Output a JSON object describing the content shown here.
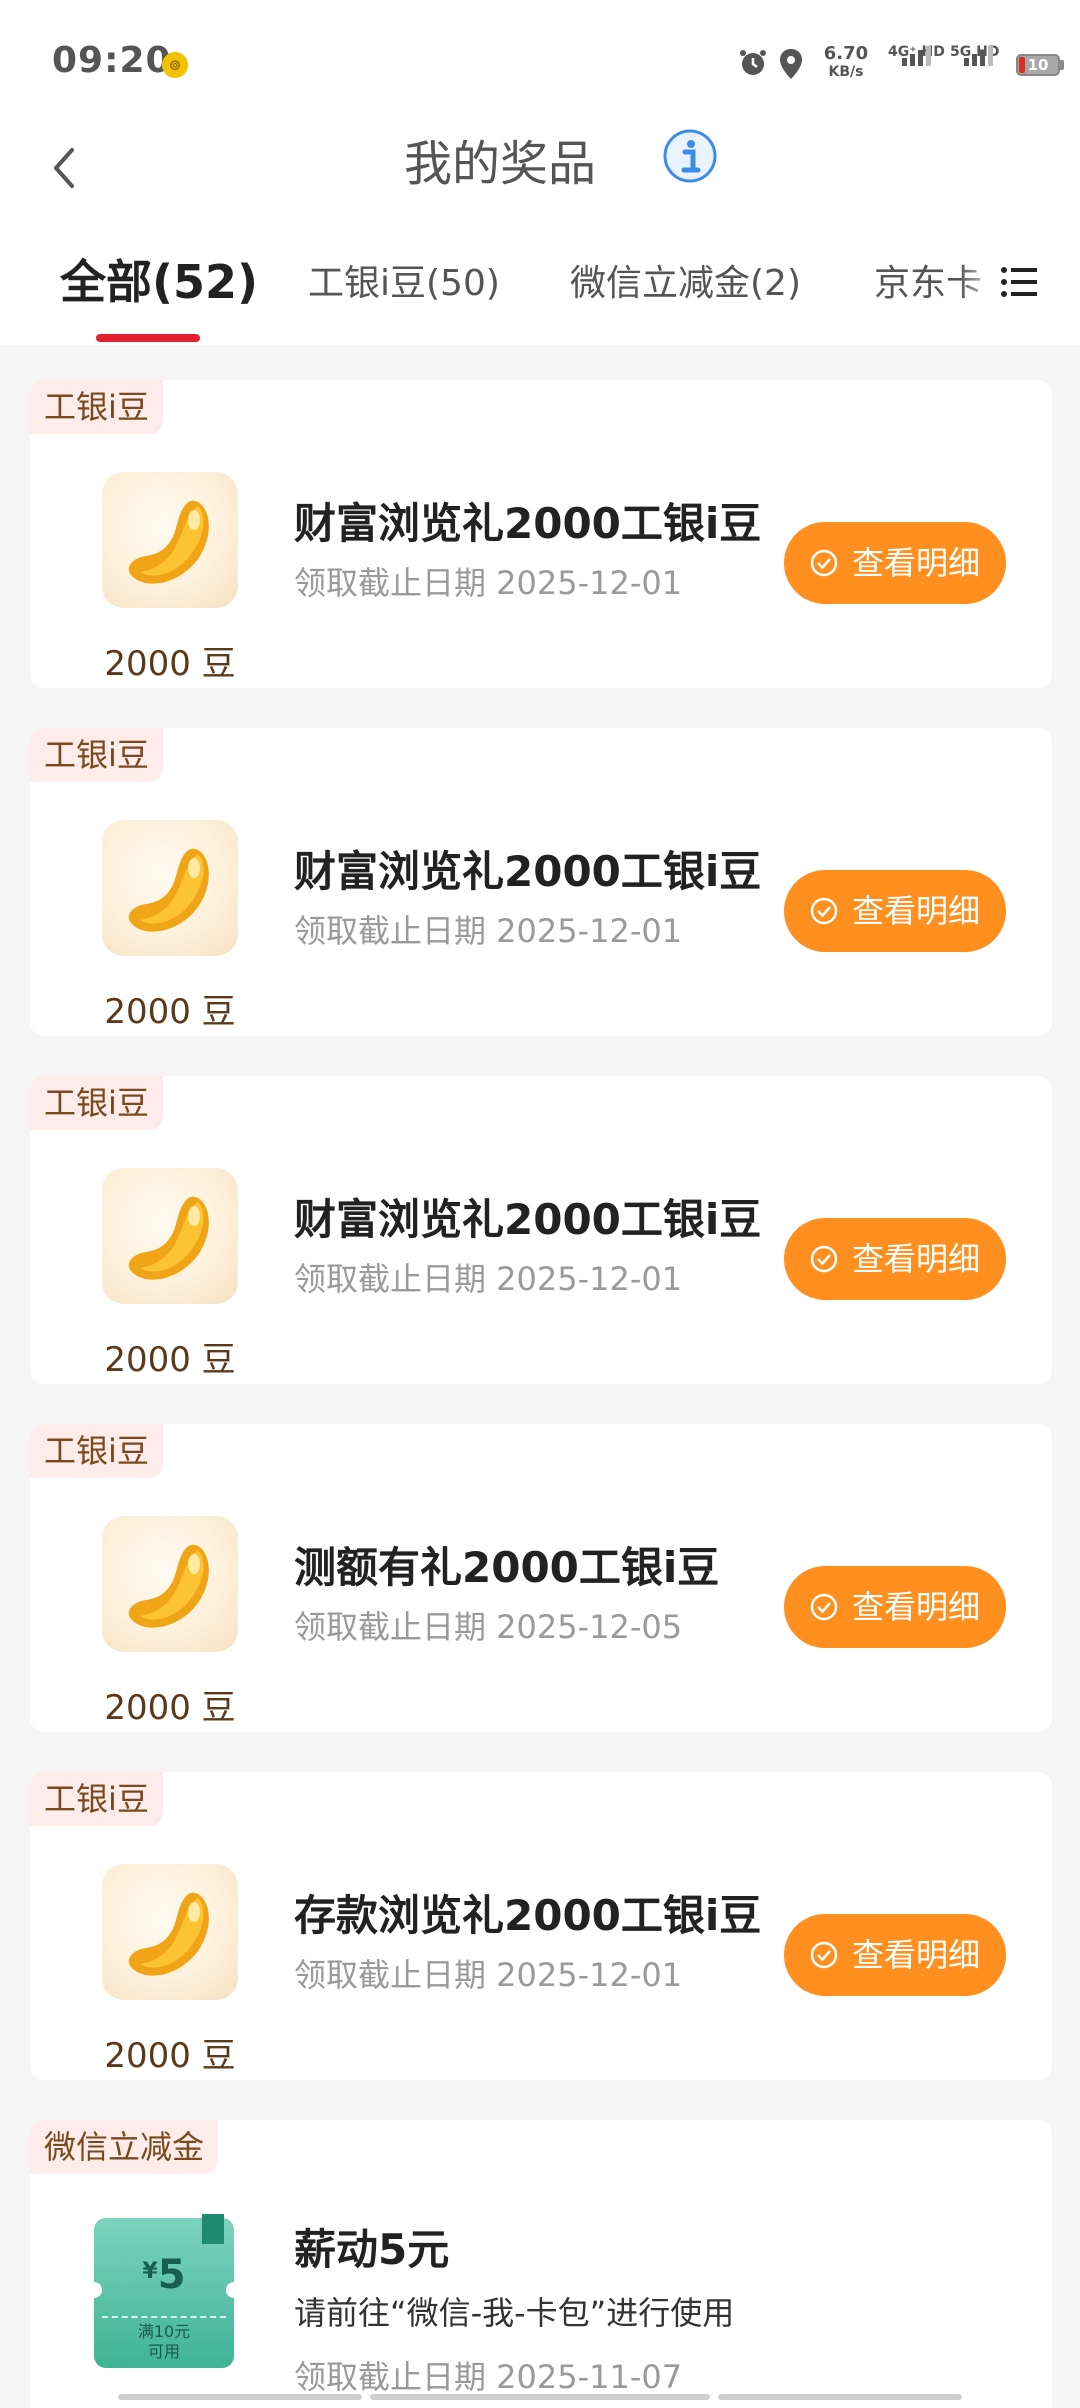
{
  "status_bar": {
    "time": "09:20",
    "speed_value": "6.70",
    "speed_unit": "KB/s",
    "net1": "4G⁺ HD",
    "net2": "5G HD",
    "battery": "10"
  },
  "header": {
    "title": "我的奖品"
  },
  "tabs": [
    {
      "label": "全部(52)"
    },
    {
      "label": "工银i豆(50)"
    },
    {
      "label": "微信立减金(2)"
    },
    {
      "label": "京东卡"
    }
  ],
  "cards": [
    {
      "tag": "工银i豆",
      "title": "财富浏览礼2000工银i豆",
      "date": "领取截止日期 2025-12-01",
      "amount": "2000 豆",
      "button": "查看明细"
    },
    {
      "tag": "工银i豆",
      "title": "财富浏览礼2000工银i豆",
      "date": "领取截止日期 2025-12-01",
      "amount": "2000 豆",
      "button": "查看明细"
    },
    {
      "tag": "工银i豆",
      "title": "财富浏览礼2000工银i豆",
      "date": "领取截止日期 2025-12-01",
      "amount": "2000 豆",
      "button": "查看明细"
    },
    {
      "tag": "工银i豆",
      "title": "测额有礼2000工银i豆",
      "date": "领取截止日期 2025-12-05",
      "amount": "2000 豆",
      "button": "查看明细"
    },
    {
      "tag": "工银i豆",
      "title": "存款浏览礼2000工银i豆",
      "date": "领取截止日期 2025-12-01",
      "amount": "2000 豆",
      "button": "查看明细"
    }
  ],
  "wechat_card": {
    "tag": "微信立减金",
    "title": "薪动5元",
    "instruction": "请前往“微信-我-卡包”进行使用",
    "date": "领取截止日期 2025-11-07",
    "voucher_currency": "¥",
    "voucher_amount": "5",
    "voucher_condition_1": "满10元",
    "voucher_condition_2": "可用"
  },
  "colors": {
    "accent_red": "#e1212e",
    "button_orange": "#ff8f1f",
    "tag_bg": "#fdecea"
  }
}
